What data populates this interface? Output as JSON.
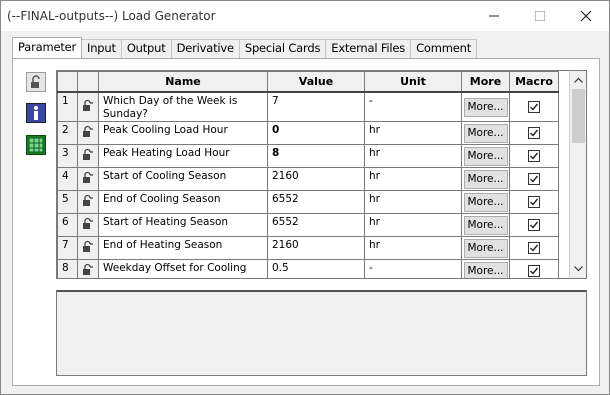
{
  "window": {
    "title": "(--FINAL-outputs--) Load Generator"
  },
  "tabs": [
    {
      "label": "Parameter",
      "active": true
    },
    {
      "label": "Input"
    },
    {
      "label": "Output"
    },
    {
      "label": "Derivative"
    },
    {
      "label": "Special Cards"
    },
    {
      "label": "External Files"
    },
    {
      "label": "Comment"
    }
  ],
  "sidebar_icons": [
    "lock-icon",
    "info-icon",
    "table-icon"
  ],
  "grid": {
    "headers": {
      "name": "Name",
      "value": "Value",
      "unit": "Unit",
      "more": "More",
      "macro": "Macro"
    },
    "rows": [
      {
        "num": "1",
        "name": "Which Day of the Week is Sunday?",
        "value": "7",
        "unit": "-",
        "more": "More...",
        "macro": true,
        "bold": false
      },
      {
        "num": "2",
        "name": "Peak Cooling Load Hour",
        "value": "0",
        "unit": "hr",
        "more": "More...",
        "macro": true,
        "bold": true
      },
      {
        "num": "3",
        "name": "Peak Heating Load Hour",
        "value": "8",
        "unit": "hr",
        "more": "More...",
        "macro": true,
        "bold": true
      },
      {
        "num": "4",
        "name": "Start of Cooling Season",
        "value": "2160",
        "unit": "hr",
        "more": "More...",
        "macro": true,
        "bold": false
      },
      {
        "num": "5",
        "name": "End of Cooling Season",
        "value": "6552",
        "unit": "hr",
        "more": "More...",
        "macro": true,
        "bold": false
      },
      {
        "num": "6",
        "name": "Start of Heating Season",
        "value": "6552",
        "unit": "hr",
        "more": "More...",
        "macro": true,
        "bold": false
      },
      {
        "num": "7",
        "name": "End of Heating Season",
        "value": "2160",
        "unit": "hr",
        "more": "More...",
        "macro": true,
        "bold": false
      },
      {
        "num": "8",
        "name": "Weekday Offset for Cooling",
        "value": "0.5",
        "unit": "-",
        "more": "More...",
        "macro": true,
        "bold": false
      }
    ]
  },
  "description": ""
}
